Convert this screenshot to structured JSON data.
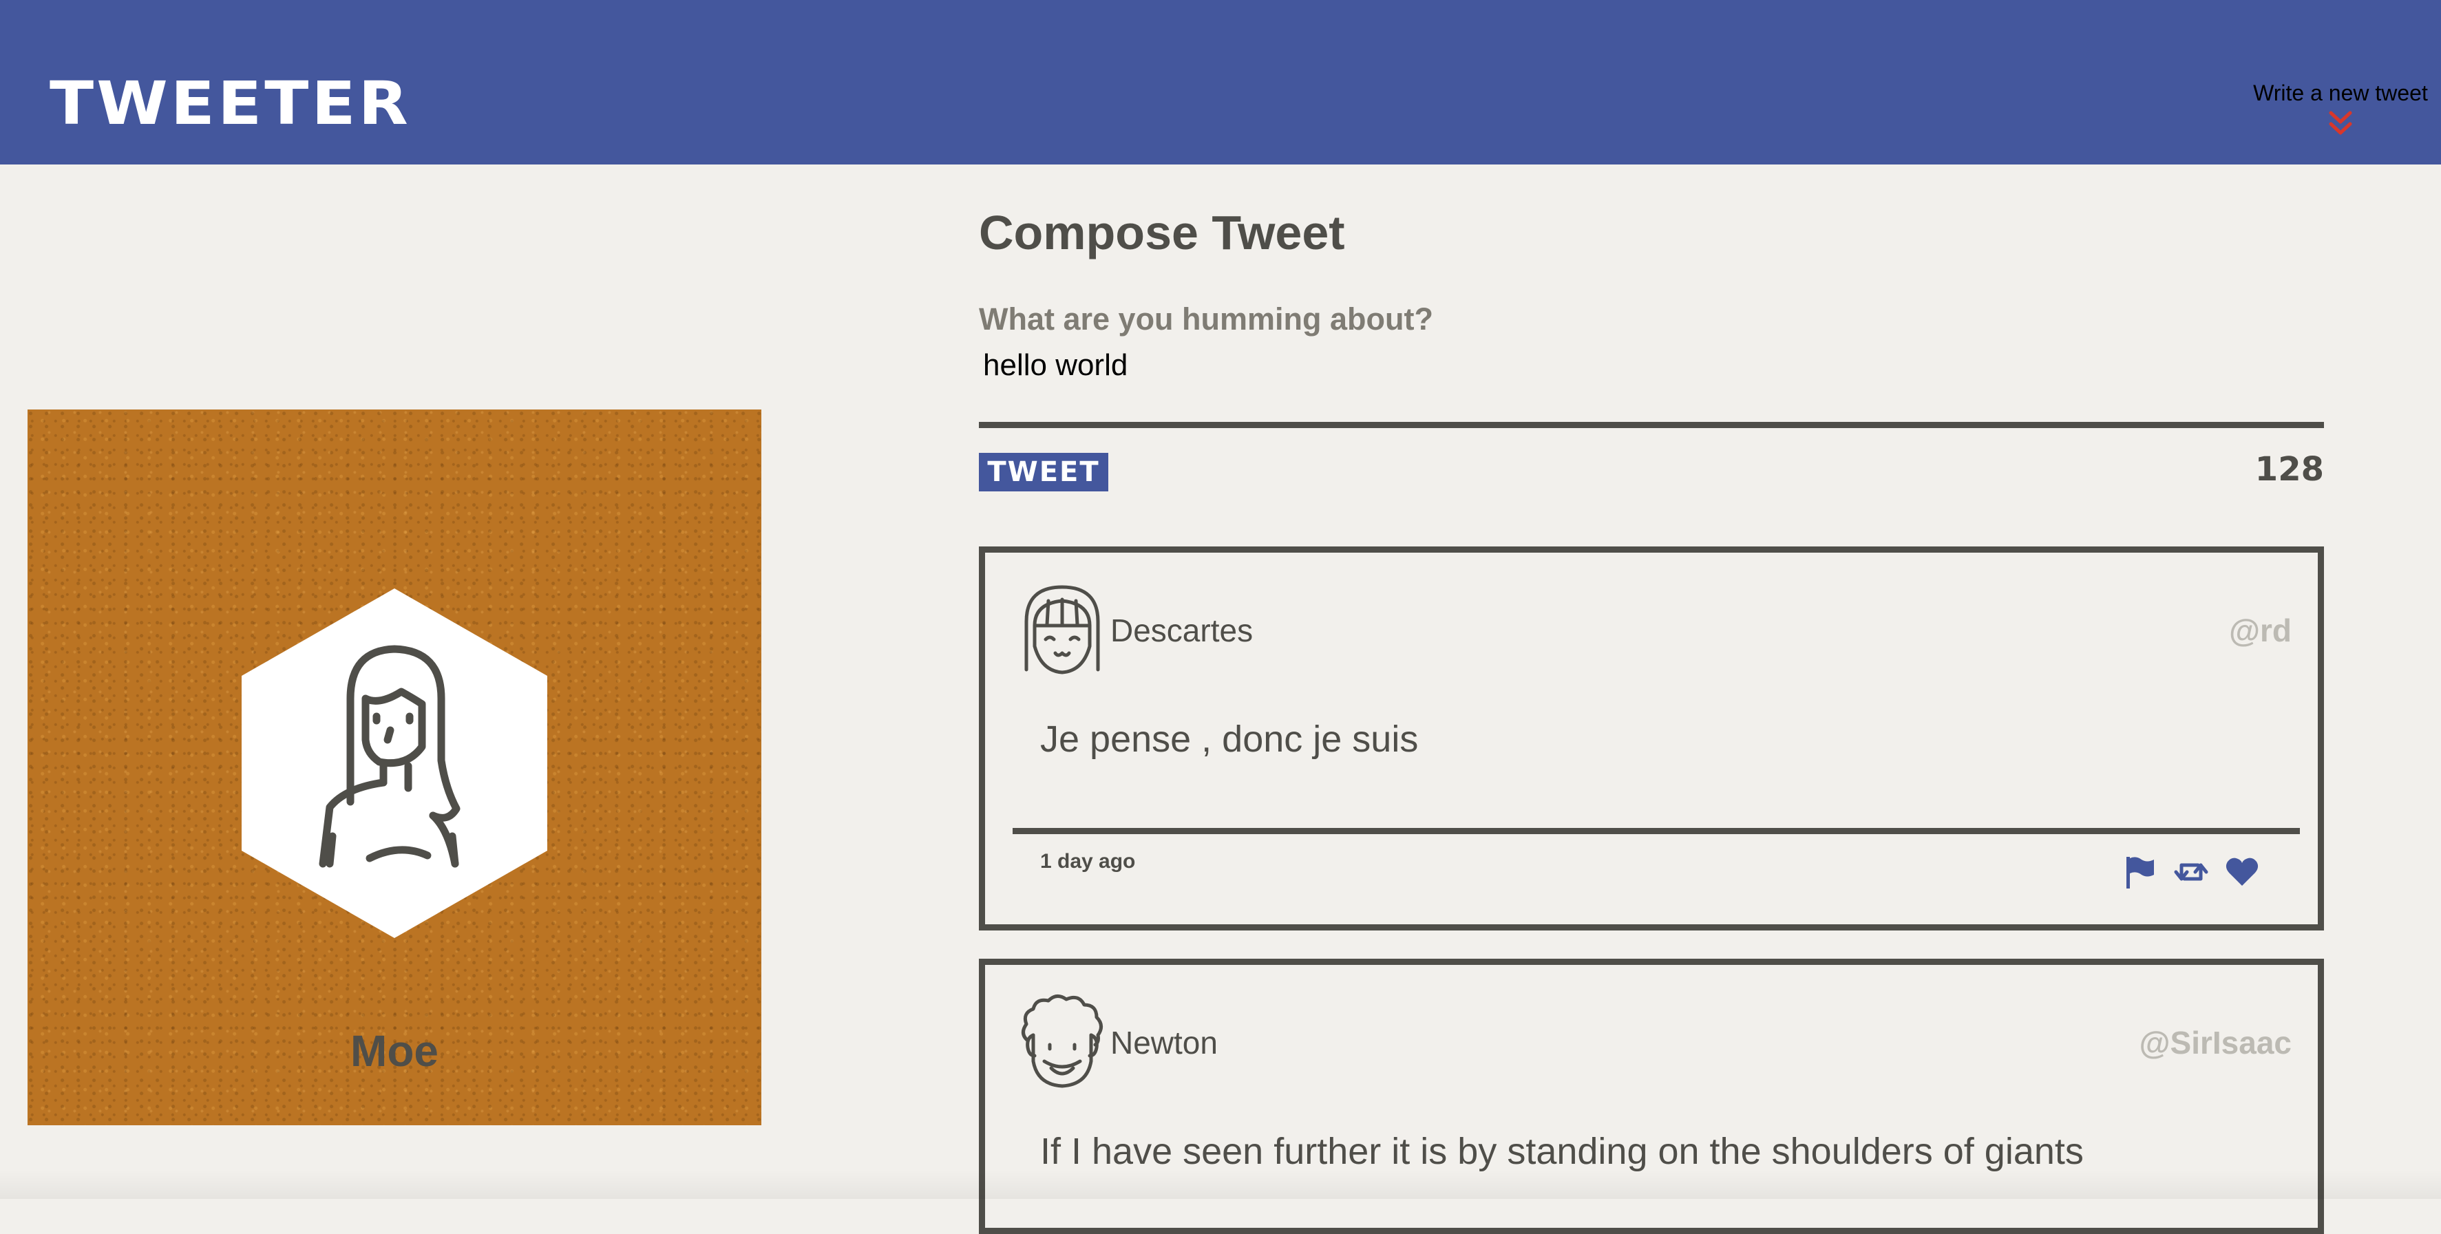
{
  "nav": {
    "brand": "TWEETER",
    "write_toggle_label": "Write a new tweet",
    "write_toggle_icon": "double-chevron-down-icon",
    "accent_color": "#44579d",
    "toggle_icon_color": "#d9372a"
  },
  "profile": {
    "name": "Moe",
    "avatar_icon": "user-avatar-icon",
    "background_color": "#bb7423"
  },
  "compose": {
    "title": "Compose Tweet",
    "prompt": "What are you humming about?",
    "input_value": "hello world",
    "submit_label": "TWEET",
    "char_count": "128"
  },
  "tweets": [
    {
      "author": "Descartes",
      "handle": "@rd",
      "text": "Je pense , donc je suis",
      "time": "1 day ago",
      "avatar_icon": "bangs-avatar-icon",
      "actions": [
        "flag-icon",
        "retweet-icon",
        "heart-icon"
      ]
    },
    {
      "author": "Newton",
      "handle": "@SirIsaac",
      "text": "If I have seen further it is by standing on the shoulders of giants",
      "avatar_icon": "curly-hair-avatar-icon"
    }
  ]
}
